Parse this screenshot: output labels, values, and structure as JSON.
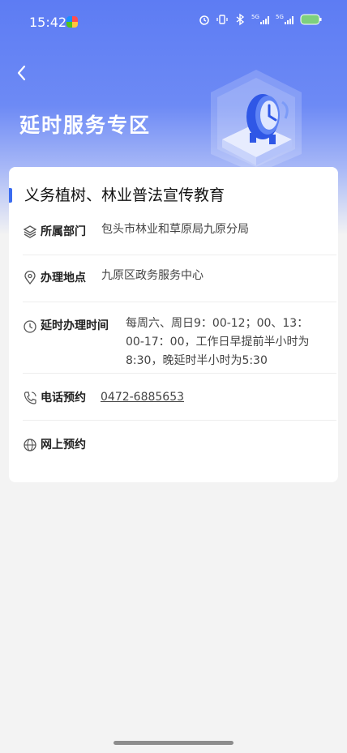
{
  "status": {
    "time": "15:42"
  },
  "header": {
    "title": "延时服务专区"
  },
  "service": {
    "title": "义务植树、林业普法宣传教育",
    "department_label": "所属部门",
    "department_value": "包头市林业和草原局九原分局",
    "location_label": "办理地点",
    "location_value": "九原区政务服务中心",
    "time_label": "延时办理时间",
    "time_value_1": "每周六、周日9：00-12；00、13：",
    "time_value_2": "00-17：00，工作日早提前半小时为",
    "time_value_3": "8:30，晚延时半小时为5:30",
    "phone_label": "电话预约",
    "phone_value": "0472-6885653",
    "online_label": "网上预约"
  }
}
